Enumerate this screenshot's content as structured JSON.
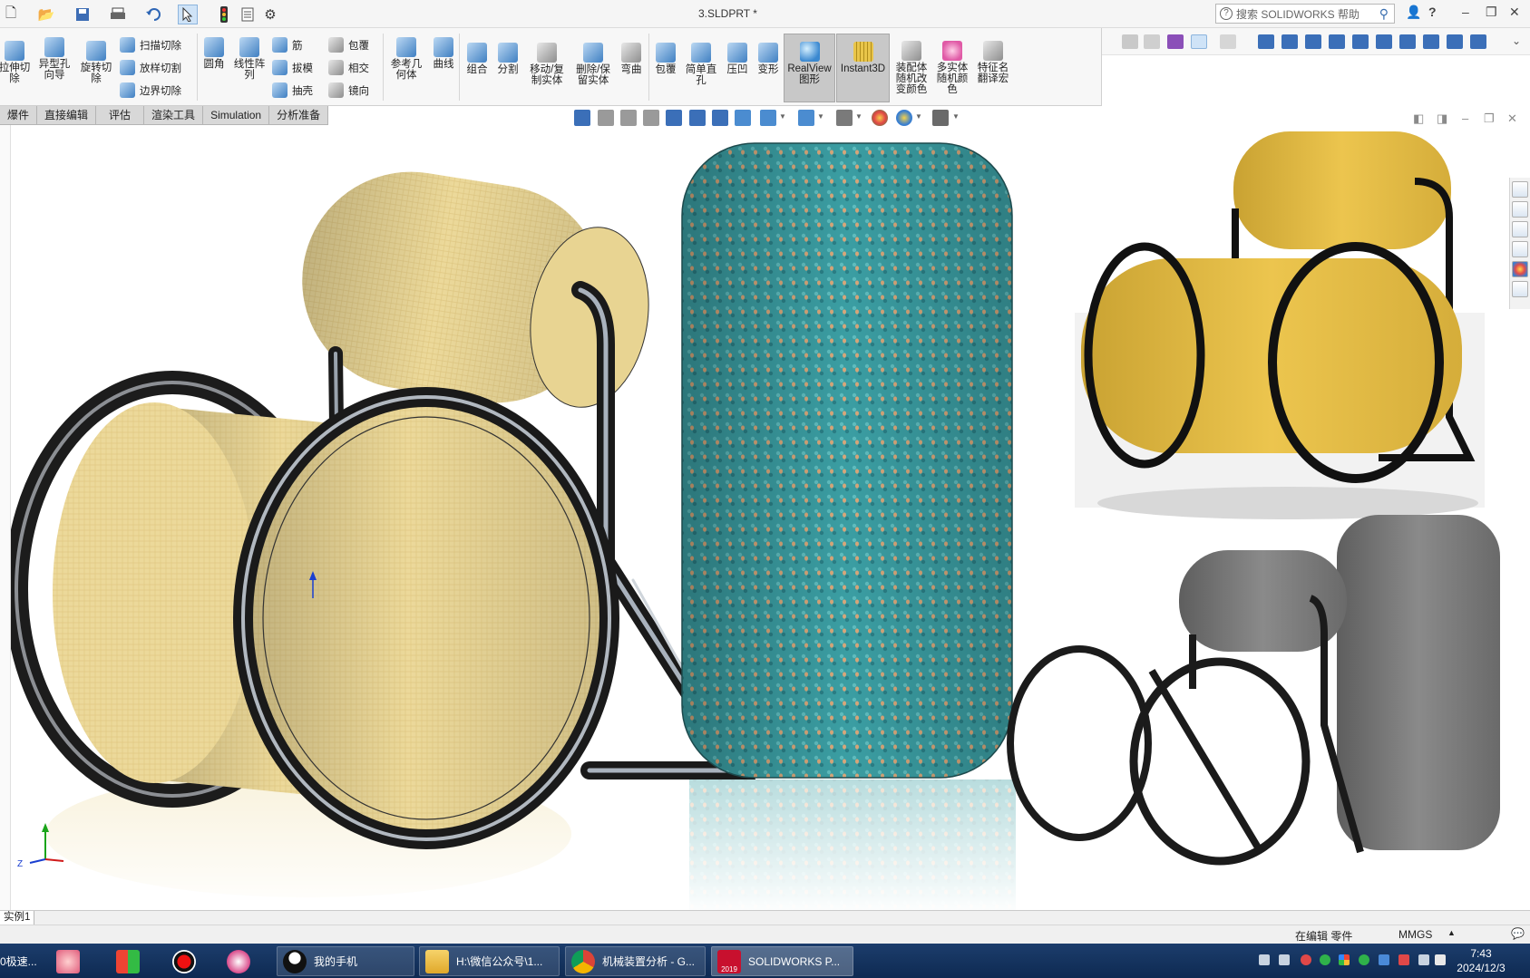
{
  "window": {
    "title": "3.SLDPRT *",
    "search_placeholder": "搜索 SOLIDWORKS 帮助",
    "help_glyph": "?"
  },
  "ribbon": {
    "buttons": [
      {
        "id": "cut-extrude",
        "label": "拉伸切\n除"
      },
      {
        "id": "hole-wizard",
        "label": "异型孔\n向导"
      },
      {
        "id": "revolve-cut",
        "label": "旋转切\n除"
      },
      {
        "id": "fillet",
        "label": "圆角"
      },
      {
        "id": "linear-pattern",
        "label": "线性阵\n列"
      },
      {
        "id": "ref-geometry",
        "label": "参考几\n何体"
      },
      {
        "id": "curves",
        "label": "曲线"
      },
      {
        "id": "combine",
        "label": "组合"
      },
      {
        "id": "split",
        "label": "分割"
      },
      {
        "id": "move-copy-body",
        "label": "移动/复\n制实体"
      },
      {
        "id": "delete-keep-body",
        "label": "删除/保\n留实体"
      },
      {
        "id": "flex",
        "label": "弯曲"
      },
      {
        "id": "wrap",
        "label": "包覆"
      },
      {
        "id": "simple-hole",
        "label": "简单直\n孔"
      },
      {
        "id": "indent",
        "label": "压凹"
      },
      {
        "id": "deform",
        "label": "变形"
      },
      {
        "id": "realview",
        "label": "RealView\n图形"
      },
      {
        "id": "instant3d",
        "label": "Instant3D"
      },
      {
        "id": "assembly-color",
        "label": "装配体\n随机改\n变颜色"
      },
      {
        "id": "body-color",
        "label": "多实体\n随机颜\n色"
      },
      {
        "id": "feature-rename",
        "label": "特征名\n翻译宏"
      }
    ],
    "small_buttons": [
      {
        "id": "swept-cut",
        "label": "扫描切除"
      },
      {
        "id": "lofted-cut",
        "label": "放样切割"
      },
      {
        "id": "boundary-cut",
        "label": "边界切除"
      },
      {
        "id": "rib",
        "label": "筋"
      },
      {
        "id": "draft",
        "label": "拔模"
      },
      {
        "id": "shell",
        "label": "抽壳"
      },
      {
        "id": "wrap-small",
        "label": "包覆"
      },
      {
        "id": "intersect",
        "label": "相交"
      },
      {
        "id": "mirror",
        "label": "镜向"
      }
    ]
  },
  "tabs": [
    "爆件",
    "直接编辑",
    "评估",
    "渲染工具",
    "Simulation",
    "分析准备"
  ],
  "viewport": {
    "triad_label": "Z",
    "colors": {
      "seat_fabric": "#ecd99a",
      "teal_fabric": "#3b9ea3",
      "dot_orange": "#d8a77a",
      "yellow_photo": "#ecc54e",
      "gray_photo": "#7b7b7b",
      "chrome": "#2a2a2a"
    }
  },
  "model_tab": "实例1",
  "status": {
    "mode": "在编辑 零件",
    "units": "MMGS"
  },
  "taskbar": {
    "items": [
      {
        "id": "speed",
        "label": "0极速..."
      },
      {
        "id": "phone",
        "label": "我的手机"
      },
      {
        "id": "explorer",
        "label": "H:\\微信公众号\\1..."
      },
      {
        "id": "chrome",
        "label": "机械装置分析 - G..."
      },
      {
        "id": "solidworks",
        "label": "SOLIDWORKS P..."
      }
    ],
    "sw_badge": "2019",
    "clock_time": "7:43",
    "clock_date": "2024/12/3"
  }
}
